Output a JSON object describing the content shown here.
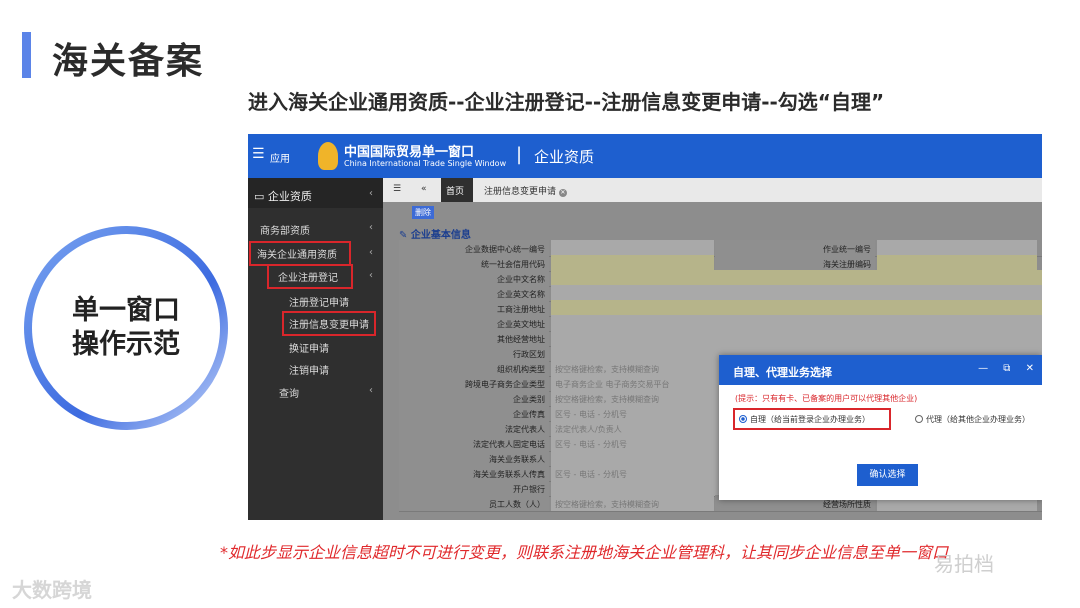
{
  "slide": {
    "title": "海关备案",
    "subtitle": "进入海关企业通用资质--企业注册登记--注册信息变更申请--勾选“自理”",
    "circle_line1": "单一窗口",
    "circle_line2": "操作示范",
    "note": "*如此步显示企业信息超时不可进行变更，则联系注册地海关企业管理科，让其同步企业信息至单一窗口",
    "watermark_left": "大数跨境",
    "watermark_right": "易拍档"
  },
  "app": {
    "menu_label": "应用",
    "brand_cn": "中国国际贸易单一窗口",
    "brand_en": "China International Trade Single Window",
    "separator": "|",
    "section": "企业资质"
  },
  "sidebar": {
    "header": "企业资质",
    "items": [
      {
        "label": "商务部资质"
      },
      {
        "label": "海关企业通用资质"
      },
      {
        "label": "企业注册登记"
      },
      {
        "label": "注册登记申请"
      },
      {
        "label": "注册信息变更申请"
      },
      {
        "label": "换证申请"
      },
      {
        "label": "注销申请"
      },
      {
        "label": "查询"
      }
    ]
  },
  "tabs": {
    "home": "首页",
    "active": "注册信息变更申请"
  },
  "content": {
    "delete_label": "删除",
    "section_title": "企业基本信息",
    "rows": [
      {
        "label": "企业数据中心统一编号",
        "value": "",
        "label2": "作业统一编号"
      },
      {
        "label": "统一社会信用代码",
        "value": "",
        "label2": "海关注册编码"
      },
      {
        "label": "企业中文名称",
        "value": ""
      },
      {
        "label": "企业英文名称",
        "value": ""
      },
      {
        "label": "工商注册地址",
        "value": ""
      },
      {
        "label": "企业英文地址",
        "value": ""
      },
      {
        "label": "其他经营地址",
        "value": ""
      },
      {
        "label": "行政区划",
        "value": ""
      },
      {
        "label": "组织机构类型",
        "value": "按空格键检索，支持模糊查询"
      },
      {
        "label": "跨境电子商务企业类型",
        "value": "电子商务企业    电子商务交易平台"
      },
      {
        "label": "企业类别",
        "value": "按空格键检索，支持模糊查询"
      },
      {
        "label": "企业传真",
        "value": "区号  -   电话   -   分机号"
      },
      {
        "label": "法定代表人",
        "value": "法定代表人/负责人"
      },
      {
        "label": "法定代表人固定电话",
        "value": "区号  -   电话   -   分机号"
      },
      {
        "label": "海关业务联系人",
        "value": ""
      },
      {
        "label": "海关业务联系人传真",
        "value": "区号  -   电话   -   分机号"
      },
      {
        "label": "开户银行",
        "value": ""
      },
      {
        "label": "员工人数（人）",
        "value": "按空格键检索，支持模糊查询",
        "label2": "经营场所性质"
      }
    ]
  },
  "dialog": {
    "title": "自理、代理业务选择",
    "controls": "— ⧉ ✕",
    "hint": "(提示：只有有卡、已备案的用户可以代理其他企业)",
    "option_self": "自理（给当前登录企业办理业务）",
    "option_agent": "代理（给其他企业办理业务）",
    "confirm": "确认选择"
  }
}
